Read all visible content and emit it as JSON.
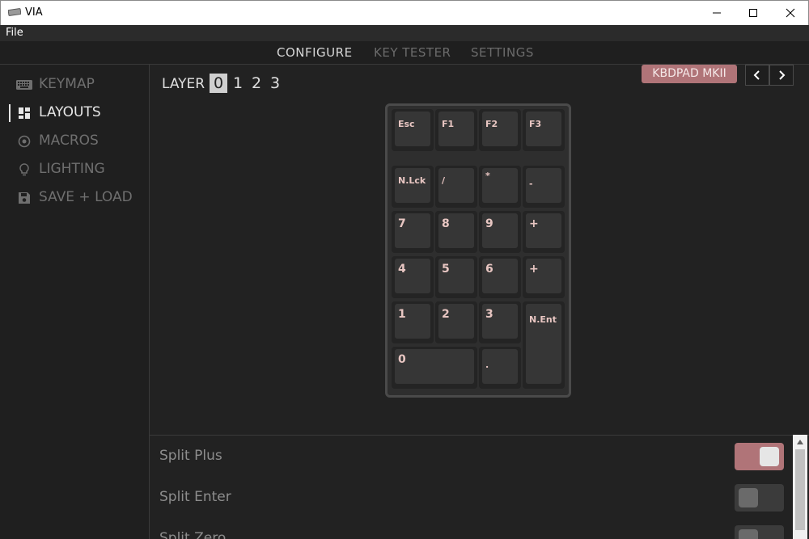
{
  "window": {
    "title": "VIA"
  },
  "menu": {
    "file": "File"
  },
  "tabs": [
    {
      "label": "CONFIGURE",
      "active": true
    },
    {
      "label": "KEY TESTER",
      "active": false
    },
    {
      "label": "SETTINGS",
      "active": false
    }
  ],
  "sidebar": {
    "items": [
      {
        "label": "KEYMAP",
        "icon": "keyboard-icon",
        "active": false
      },
      {
        "label": "LAYOUTS",
        "icon": "dashboard-icon",
        "active": true
      },
      {
        "label": "MACROS",
        "icon": "circle-dot-icon",
        "active": false
      },
      {
        "label": "LIGHTING",
        "icon": "lightbulb-icon",
        "active": false
      },
      {
        "label": "SAVE + LOAD",
        "icon": "floppy-icon",
        "active": false
      }
    ]
  },
  "layer": {
    "label": "LAYER",
    "numbers": [
      "0",
      "1",
      "2",
      "3"
    ],
    "selected": "0"
  },
  "keyboard_name": "KBDPAD MKII",
  "keys": {
    "esc": "Esc",
    "f1": "F1",
    "f2": "F2",
    "f3": "F3",
    "nlck": "N.Lck",
    "slash": "/",
    "star": "*",
    "minus": "-",
    "k7": "7",
    "k8": "8",
    "k9": "9",
    "plus1": "+",
    "k4": "4",
    "k5": "5",
    "k6": "6",
    "plus2": "+",
    "k1": "1",
    "k2": "2",
    "k3": "3",
    "nent": "N.Ent",
    "k0": "0",
    "dot": "."
  },
  "options": [
    {
      "label": "Split Plus",
      "enabled": true
    },
    {
      "label": "Split Enter",
      "enabled": false
    },
    {
      "label": "Split Zero",
      "enabled": false
    }
  ],
  "colors": {
    "accent": "#b07478",
    "legend": "#e8c6c2",
    "background": "#222222"
  }
}
